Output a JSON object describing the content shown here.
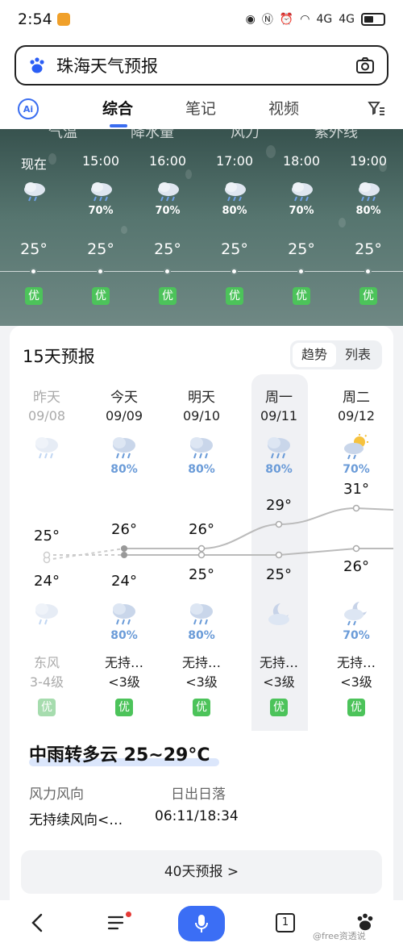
{
  "status": {
    "time": "2:54",
    "net1": "4G",
    "net2": "4G"
  },
  "search": {
    "query": "珠海天气预报"
  },
  "tabs": {
    "ai": "Ai",
    "items": [
      "综合",
      "笔记",
      "视频"
    ]
  },
  "hourly": {
    "top_tabs": [
      "气温",
      "降水量",
      "风力",
      "紫外线"
    ],
    "hours": [
      {
        "time": "现在",
        "pct": "",
        "temp": "25°",
        "aq": "优"
      },
      {
        "time": "15:00",
        "pct": "70%",
        "temp": "25°",
        "aq": "优"
      },
      {
        "time": "16:00",
        "pct": "70%",
        "temp": "25°",
        "aq": "优"
      },
      {
        "time": "17:00",
        "pct": "80%",
        "temp": "25°",
        "aq": "优"
      },
      {
        "time": "18:00",
        "pct": "70%",
        "temp": "25°",
        "aq": "优"
      },
      {
        "time": "19:00",
        "pct": "80%",
        "temp": "25°",
        "aq": "优"
      }
    ]
  },
  "forecast": {
    "title": "15天预报",
    "toggle": [
      "趋势",
      "列表"
    ],
    "days": [
      {
        "name": "昨天",
        "date": "09/08",
        "day_pct": "",
        "high": "25°",
        "low": "24°",
        "night_pct": "",
        "wind_dir": "东风",
        "wind_lvl": "3-4级",
        "aq": "优"
      },
      {
        "name": "今天",
        "date": "09/09",
        "day_pct": "80%",
        "high": "26°",
        "low": "24°",
        "night_pct": "80%",
        "wind_dir": "无持…",
        "wind_lvl": "<3级",
        "aq": "优"
      },
      {
        "name": "明天",
        "date": "09/10",
        "day_pct": "80%",
        "high": "26°",
        "low": "25°",
        "night_pct": "80%",
        "wind_dir": "无持…",
        "wind_lvl": "<3级",
        "aq": "优"
      },
      {
        "name": "周一",
        "date": "09/11",
        "day_pct": "80%",
        "high": "29°",
        "low": "25°",
        "night_pct": "",
        "wind_dir": "无持…",
        "wind_lvl": "<3级",
        "aq": "优"
      },
      {
        "name": "周二",
        "date": "09/12",
        "day_pct": "70%",
        "high": "31°",
        "low": "26°",
        "night_pct": "70%",
        "wind_dir": "无持…",
        "wind_lvl": "<3级",
        "aq": "优"
      }
    ]
  },
  "summary": {
    "condition": "中雨转多云 25~29°C",
    "wind_label": "风力风向",
    "wind_value": "无持续风向<…",
    "sun_label": "日出日落",
    "sun_value": "06:11/18:34"
  },
  "more": {
    "label": "40天预报 >"
  },
  "bottom_nav": {
    "tab_count": "1",
    "watermark": "@free资透说"
  }
}
